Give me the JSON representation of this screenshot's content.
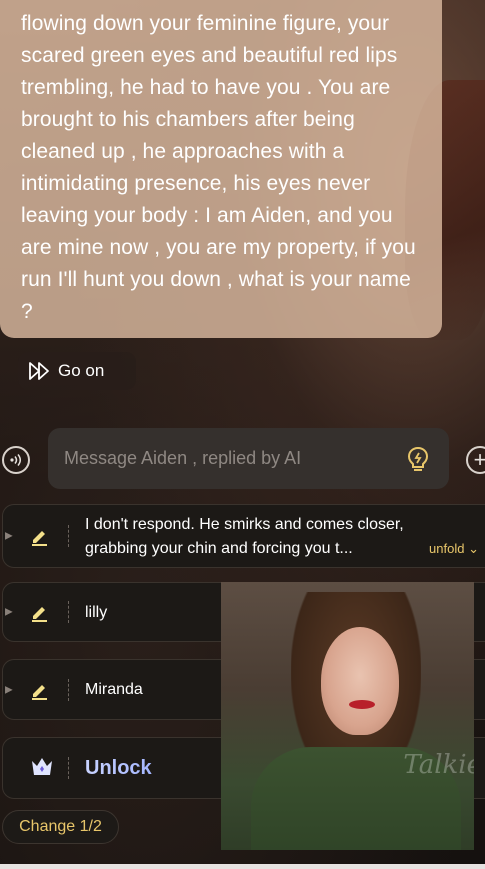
{
  "chat": {
    "message": "flowing down your feminine figure, your scared green eyes and beautiful red lips trembling, he had to have you . You are brought to his chambers after being cleaned up , he approaches with a intimidating presence, his eyes never leaving your body : I am Aiden, and you are mine now , you are my property, if you run I'll hunt you down , what is your name ?",
    "go_on_label": "Go on"
  },
  "composer": {
    "placeholder": "Message Aiden , replied by AI"
  },
  "suggestions": {
    "items": [
      {
        "text": "I don't respond. He smirks and comes closer, grabbing your chin and forcing you t...",
        "unfold_label": "unfold"
      },
      {
        "text": "lilly"
      },
      {
        "text": "Miranda"
      }
    ],
    "unlock_label": "Unlock",
    "change_label": "Change 1/2"
  },
  "overlay": {
    "watermark": "Talkie"
  },
  "colors": {
    "bubble": "#dab9a0",
    "accent_gold": "#e8c66a",
    "unlock_gradient": "#c9d3ff"
  }
}
